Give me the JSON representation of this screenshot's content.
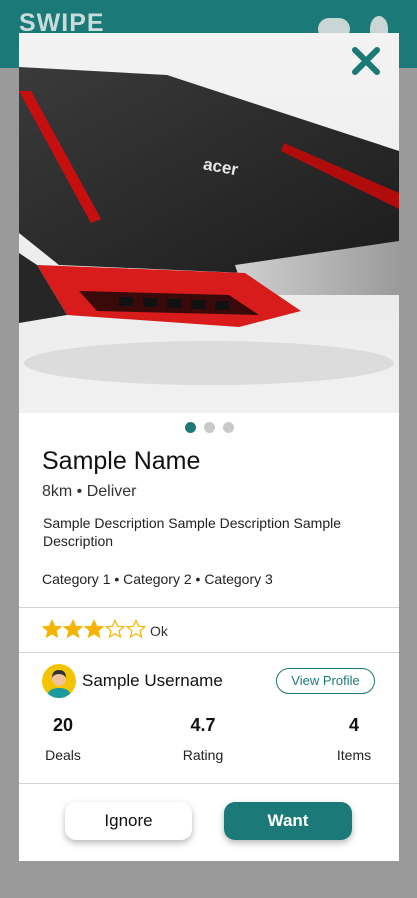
{
  "app": {
    "title": "SWIPE"
  },
  "colors": {
    "accent": "#1b7a77",
    "star": "#f5b400"
  },
  "icons": {
    "close": "close-icon",
    "chat": "chat-bubble-icon",
    "location": "drop-icon"
  },
  "product": {
    "image_alt": "acer",
    "carousel_pages": 3,
    "carousel_active_index": 0,
    "name": "Sample Name",
    "meta": "8km • Deliver",
    "description": "Sample Description Sample Description Sample Description",
    "categories": "Category 1 • Category 2 • Category 3",
    "rating_stars": 3,
    "rating_max": 5,
    "rating_label": "Ok"
  },
  "seller": {
    "username": "Sample Username",
    "view_profile_label": "View Profile",
    "stats": [
      {
        "value": "20",
        "label": "Deals"
      },
      {
        "value": "4.7",
        "label": "Rating"
      },
      {
        "value": "4",
        "label": "Items"
      }
    ]
  },
  "actions": {
    "ignore_label": "Ignore",
    "want_label": "Want"
  }
}
